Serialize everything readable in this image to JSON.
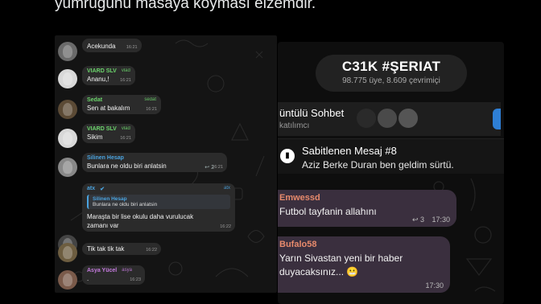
{
  "caption": "yumruğunu masaya koyması elzemdir.",
  "left_chat": {
    "messages": [
      {
        "name": "",
        "text": "Acekunda",
        "time": "16:21",
        "avatar": "#6a6a6a"
      },
      {
        "name": "VIARD SLV",
        "role": "vlad",
        "name_color": "#6bd46b",
        "text": "Ananu,!",
        "time": "16:21",
        "avatar": "#d8d8d8"
      },
      {
        "name": "Sedat",
        "role": "sedat",
        "name_color": "#6bd46b",
        "text": "Sen at bakalım",
        "time": "16:21",
        "avatar": "#5b4a35"
      },
      {
        "name": "VIARD SLV",
        "role": "vlad",
        "name_color": "#6bd46b",
        "text": "Sikim",
        "time": "16:21",
        "avatar": "#d8d8d8"
      },
      {
        "name": "Silinen Hesap",
        "role": "",
        "name_color": "#4aa3df",
        "text": "Bunlara ne oldu biri anlatsin",
        "time": "16:21",
        "forward_count": "2",
        "avatar": "#888888"
      },
      {
        "name": "atx",
        "role": "atx",
        "name_color": "#4aa3df",
        "reply_name": "Silinen Hesap",
        "reply_text": "Bunlara ne oldu biri anlatsin",
        "text": "Maraşta bir lise okulu daha vurulucak",
        "text2": "zamanı var",
        "time": "16:22",
        "avatar": "#444444"
      },
      {
        "name": "",
        "text": "Tik tak tik tak",
        "time": "16:22",
        "avatar": "#6d5d40"
      },
      {
        "name": "Asya Yücel",
        "role": "asya",
        "name_color": "#c67be0",
        "text": ".",
        "time": "16:23",
        "avatar": "#7a5a4a"
      }
    ]
  },
  "right_chat": {
    "group_title": "C31K #ŞERIAT",
    "group_subtitle": "98.775 üye, 8.609 çevrimiçi",
    "call_title": "üntülü Sohbet",
    "call_subtitle": "katılımcı",
    "pinned_title": "Sabitlenen Mesaj #8",
    "pinned_text": "Aziz Berke Duran ben geldim sürtü.",
    "messages": [
      {
        "name": "Emwessd",
        "text": "Futbol tayfanin allahını",
        "time": "17:30",
        "forward_count": "3"
      },
      {
        "name": "Bufalo58",
        "text": "Yarın Sivastan yeni bir haber",
        "text2": "duyacaksınız...",
        "emoji": "😬",
        "time": "17:30"
      }
    ]
  }
}
